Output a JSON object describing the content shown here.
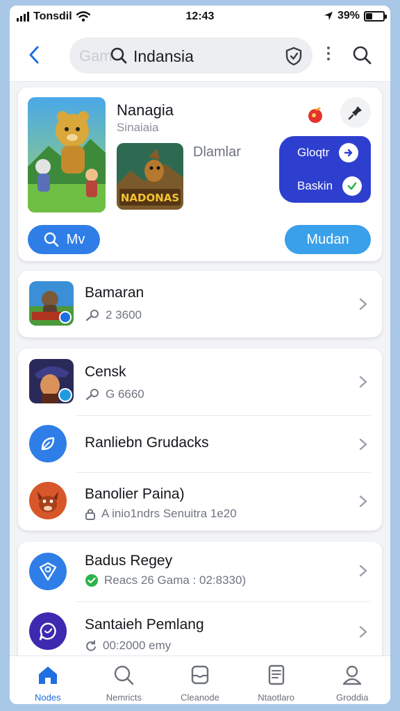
{
  "status_bar": {
    "carrier": "Tonsdil",
    "time": "12:43",
    "battery": "39%",
    "battery_level": 0.39
  },
  "top_bar": {
    "search_ghost": "Gam",
    "search_value": "Indansia"
  },
  "featured": {
    "title": "Nanagia",
    "subtitle": "Sinaiaia",
    "secondary_label": "Dlamlar",
    "game_art_text": "NADONAS",
    "promo": [
      {
        "label": "Gloqtr",
        "icon": "arrow-right-icon"
      },
      {
        "label": "Baskin",
        "icon": "check-icon"
      }
    ],
    "left_button": "Mv",
    "right_button": "Mudan"
  },
  "list_cards": [
    [
      {
        "title": "Bamaran",
        "subtitle": "2 3600",
        "icon": "game-thumbnail-bear",
        "sub_icon": "key-icon"
      }
    ],
    [
      {
        "title": "Censk",
        "subtitle": "G 6660",
        "icon": "game-thumbnail-pirate",
        "sub_icon": "key-icon"
      },
      {
        "title": "Ranliebn Grudacks",
        "subtitle": "",
        "icon": "leaf-icon"
      },
      {
        "title": "Banolier Paina)",
        "subtitle": "A inio1ndrs Senuitra 1e20",
        "icon": "avatar-fox",
        "sub_icon": "lock-icon"
      }
    ],
    [
      {
        "title": "Badus Regey",
        "subtitle": "Reacs 26 Gama : 02:8330)",
        "icon": "shield-pin-icon",
        "sub_icon": "check-circle-icon"
      },
      {
        "title": "Santaieh Pemlang",
        "subtitle": "00:2000 emy",
        "icon": "chat-icon",
        "sub_icon": "sync-icon"
      }
    ]
  ],
  "tabs": [
    {
      "label": "Nodes",
      "icon": "home-icon",
      "active": true
    },
    {
      "label": "Nemricts",
      "icon": "search-icon",
      "active": false
    },
    {
      "label": "Cleanode",
      "icon": "inbox-icon",
      "active": false
    },
    {
      "label": "Ntaotlaro",
      "icon": "document-icon",
      "active": false
    },
    {
      "label": "Groddia",
      "icon": "profile-icon",
      "active": false
    }
  ],
  "colors": {
    "accent": "#1f6fe0",
    "promo_bg": "#2e3fd0",
    "button_blue": "#2f7ee8",
    "button_light_blue": "#3aa0ea",
    "check_green": "#2bb34a",
    "badge_red": "#e5322b"
  }
}
